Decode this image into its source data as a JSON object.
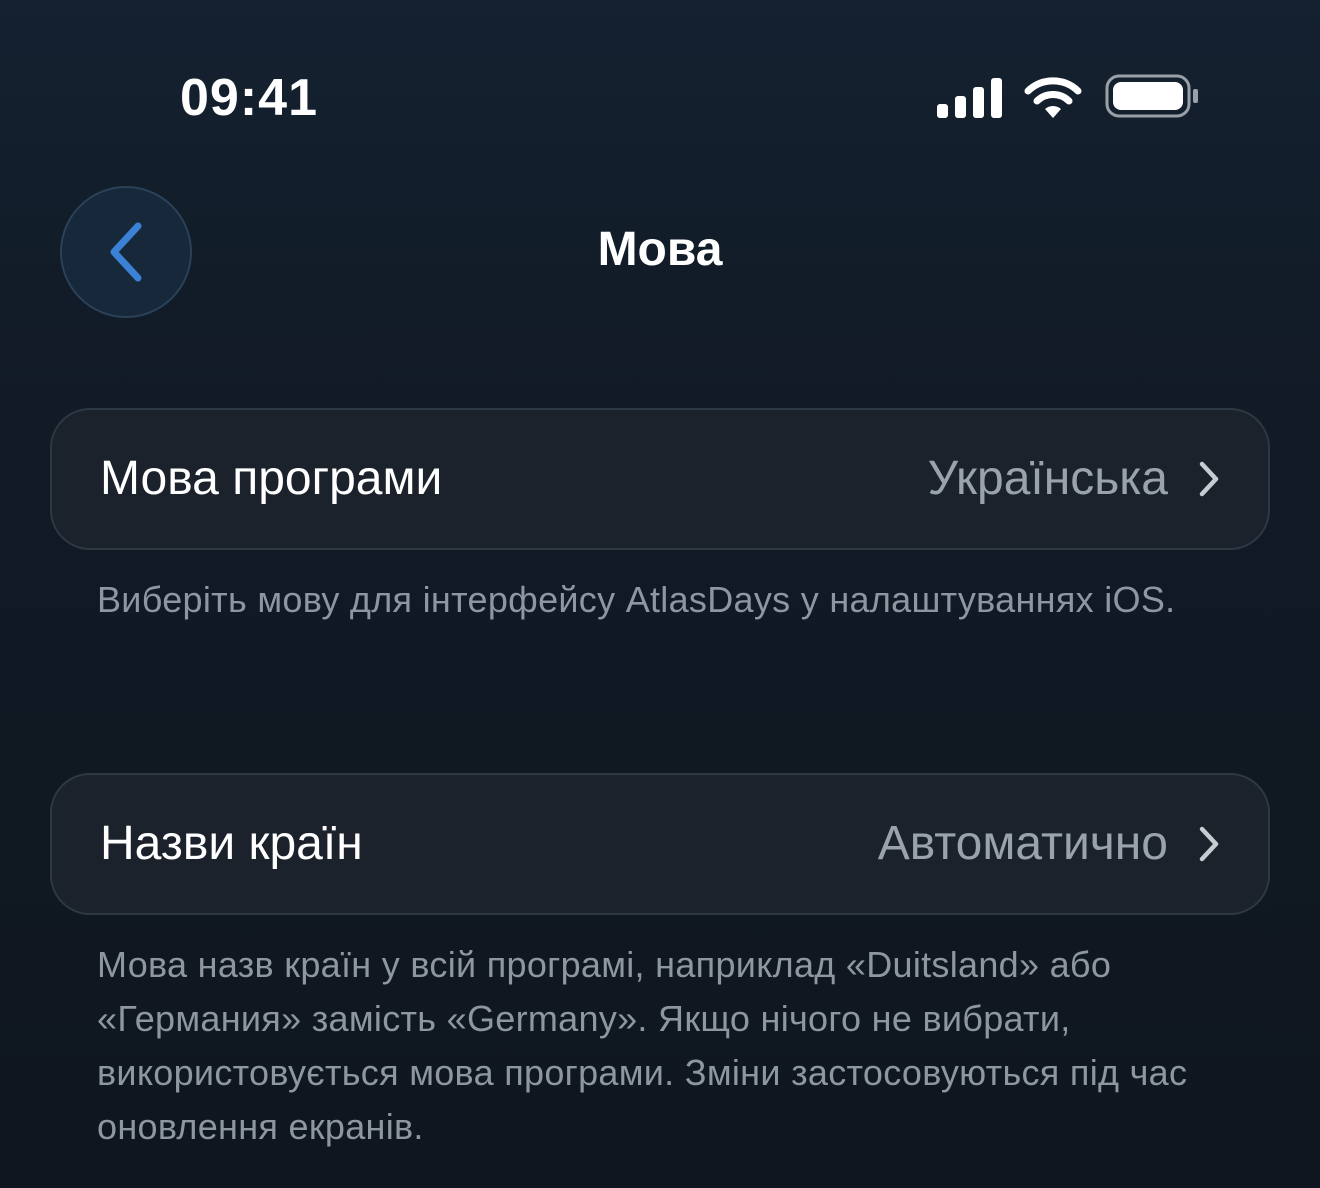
{
  "status_bar": {
    "time": "09:41",
    "icons": [
      "cellular-signal-icon",
      "wifi-icon",
      "battery-icon"
    ]
  },
  "nav": {
    "back_icon": "chevron-left-icon",
    "title": "Мова"
  },
  "settings": [
    {
      "label": "Мова програми",
      "value": "Українська",
      "footnote": "Виберіть мову для інтерфейсу AtlasDays у налаштуваннях iOS."
    },
    {
      "label": "Назви країн",
      "value": "Автоматично",
      "footnote": "Мова назв країн у всій програмі, наприклад «Duitsland» або «Германия» замість «Germany». Якщо нічого не вибрати, використовується мова програми. Зміни застосовуються під час оновлення екранів."
    }
  ],
  "colors": {
    "accent": "#3b82d6",
    "background": "#111a25",
    "card": "#1b222c",
    "secondary_text": "#9aa2ad"
  }
}
